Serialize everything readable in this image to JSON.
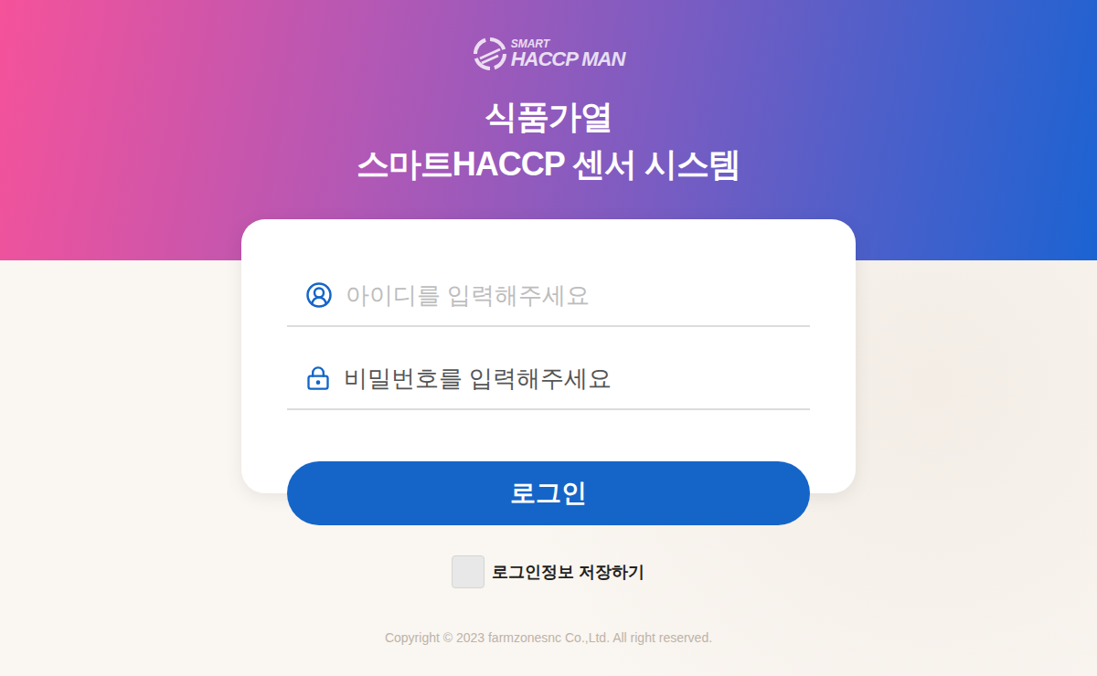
{
  "logo": {
    "top": "SMART",
    "main": "HACCP MAN"
  },
  "title": {
    "line1": "식품가열",
    "line2": "스마트HACCP 센서 시스템"
  },
  "fields": [
    {
      "kind": "text",
      "placeholder": "아이디를 입력해주세요",
      "color": "#bdbdbd"
    },
    {
      "kind": "password",
      "placeholder": "비밀번호를 입력해주세요",
      "color": "#555555"
    }
  ],
  "login_button": "로그인",
  "remember": {
    "label": "로그인정보 저장하기",
    "checked": false
  },
  "footer": "Copyright © 2023 farmzonesnc Co.,Ltd. All right reserved."
}
